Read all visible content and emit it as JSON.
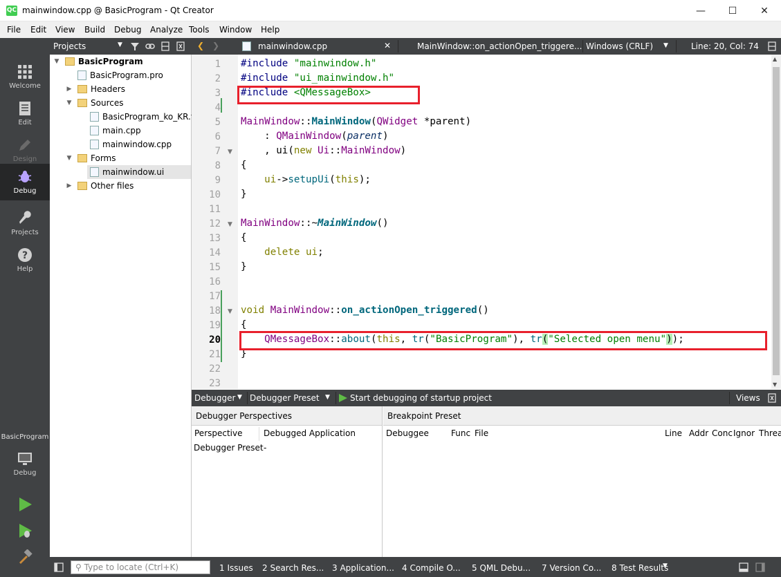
{
  "window": {
    "title": "mainwindow.cpp @ BasicProgram - Qt Creator",
    "app_icon": "QC",
    "minimize": "—",
    "maximize": "☐",
    "close": "✕"
  },
  "menu": [
    "File",
    "Edit",
    "View",
    "Build",
    "Debug",
    "Analyze",
    "Tools",
    "Window",
    "Help"
  ],
  "modes": {
    "welcome": "Welcome",
    "edit": "Edit",
    "design": "Design",
    "debug": "Debug",
    "projects": "Projects",
    "help": "Help"
  },
  "kit": {
    "project": "BasicProgram",
    "config": "Debug"
  },
  "projects_panel": {
    "title": "Projects",
    "tree": {
      "root": "BasicProgram",
      "pro": "BasicProgram.pro",
      "headers": "Headers",
      "sources": "Sources",
      "ts": "BasicProgram_ko_KR.ts",
      "main": "main.cpp",
      "mainwindow": "mainwindow.cpp",
      "forms": "Forms",
      "ui": "mainwindow.ui",
      "other": "Other files"
    }
  },
  "editor_toolbar": {
    "file": "mainwindow.cpp",
    "symbol": "MainWindow::on_actionOpen_triggere...",
    "encoding": "Windows (CRLF)",
    "position": "Line: 20, Col: 74"
  },
  "editor": {
    "current_line": 20,
    "line_numbers": [
      "1",
      "2",
      "3",
      "4",
      "5",
      "6",
      "7",
      "8",
      "9",
      "10",
      "11",
      "12",
      "13",
      "14",
      "15",
      "16",
      "17",
      "18",
      "19",
      "20",
      "21",
      "22",
      "23"
    ]
  },
  "debugger": {
    "toolbar": {
      "debugger": "Debugger",
      "preset": "Debugger Preset",
      "start": "Start debugging of startup project",
      "views": "Views"
    },
    "left_pane": {
      "title": "Debugger Perspectives",
      "col_perspective": "Perspective",
      "col_app": "Debugged Application",
      "row_perspective": "Debugger Preset",
      "row_app": "-"
    },
    "right_pane": {
      "title": "Breakpoint Preset",
      "columns": [
        "Debuggee",
        "Func",
        "File",
        "Line",
        "Addr",
        "Conc",
        "Ignor",
        "Threa"
      ]
    }
  },
  "statusbar": {
    "locate_placeholder": "Type to locate (Ctrl+K)",
    "tabs": [
      "1  Issues",
      "2  Search Res...",
      "3  Application...",
      "4  Compile O...",
      "5  QML Debu...",
      "7  Version Co...",
      "8  Test Results"
    ]
  },
  "colors": {
    "sidebar": "#404244",
    "highlight_box": "#e8202c",
    "string": "#008000",
    "keyword": "#808000",
    "type": "#800080",
    "function": "#00677c"
  }
}
